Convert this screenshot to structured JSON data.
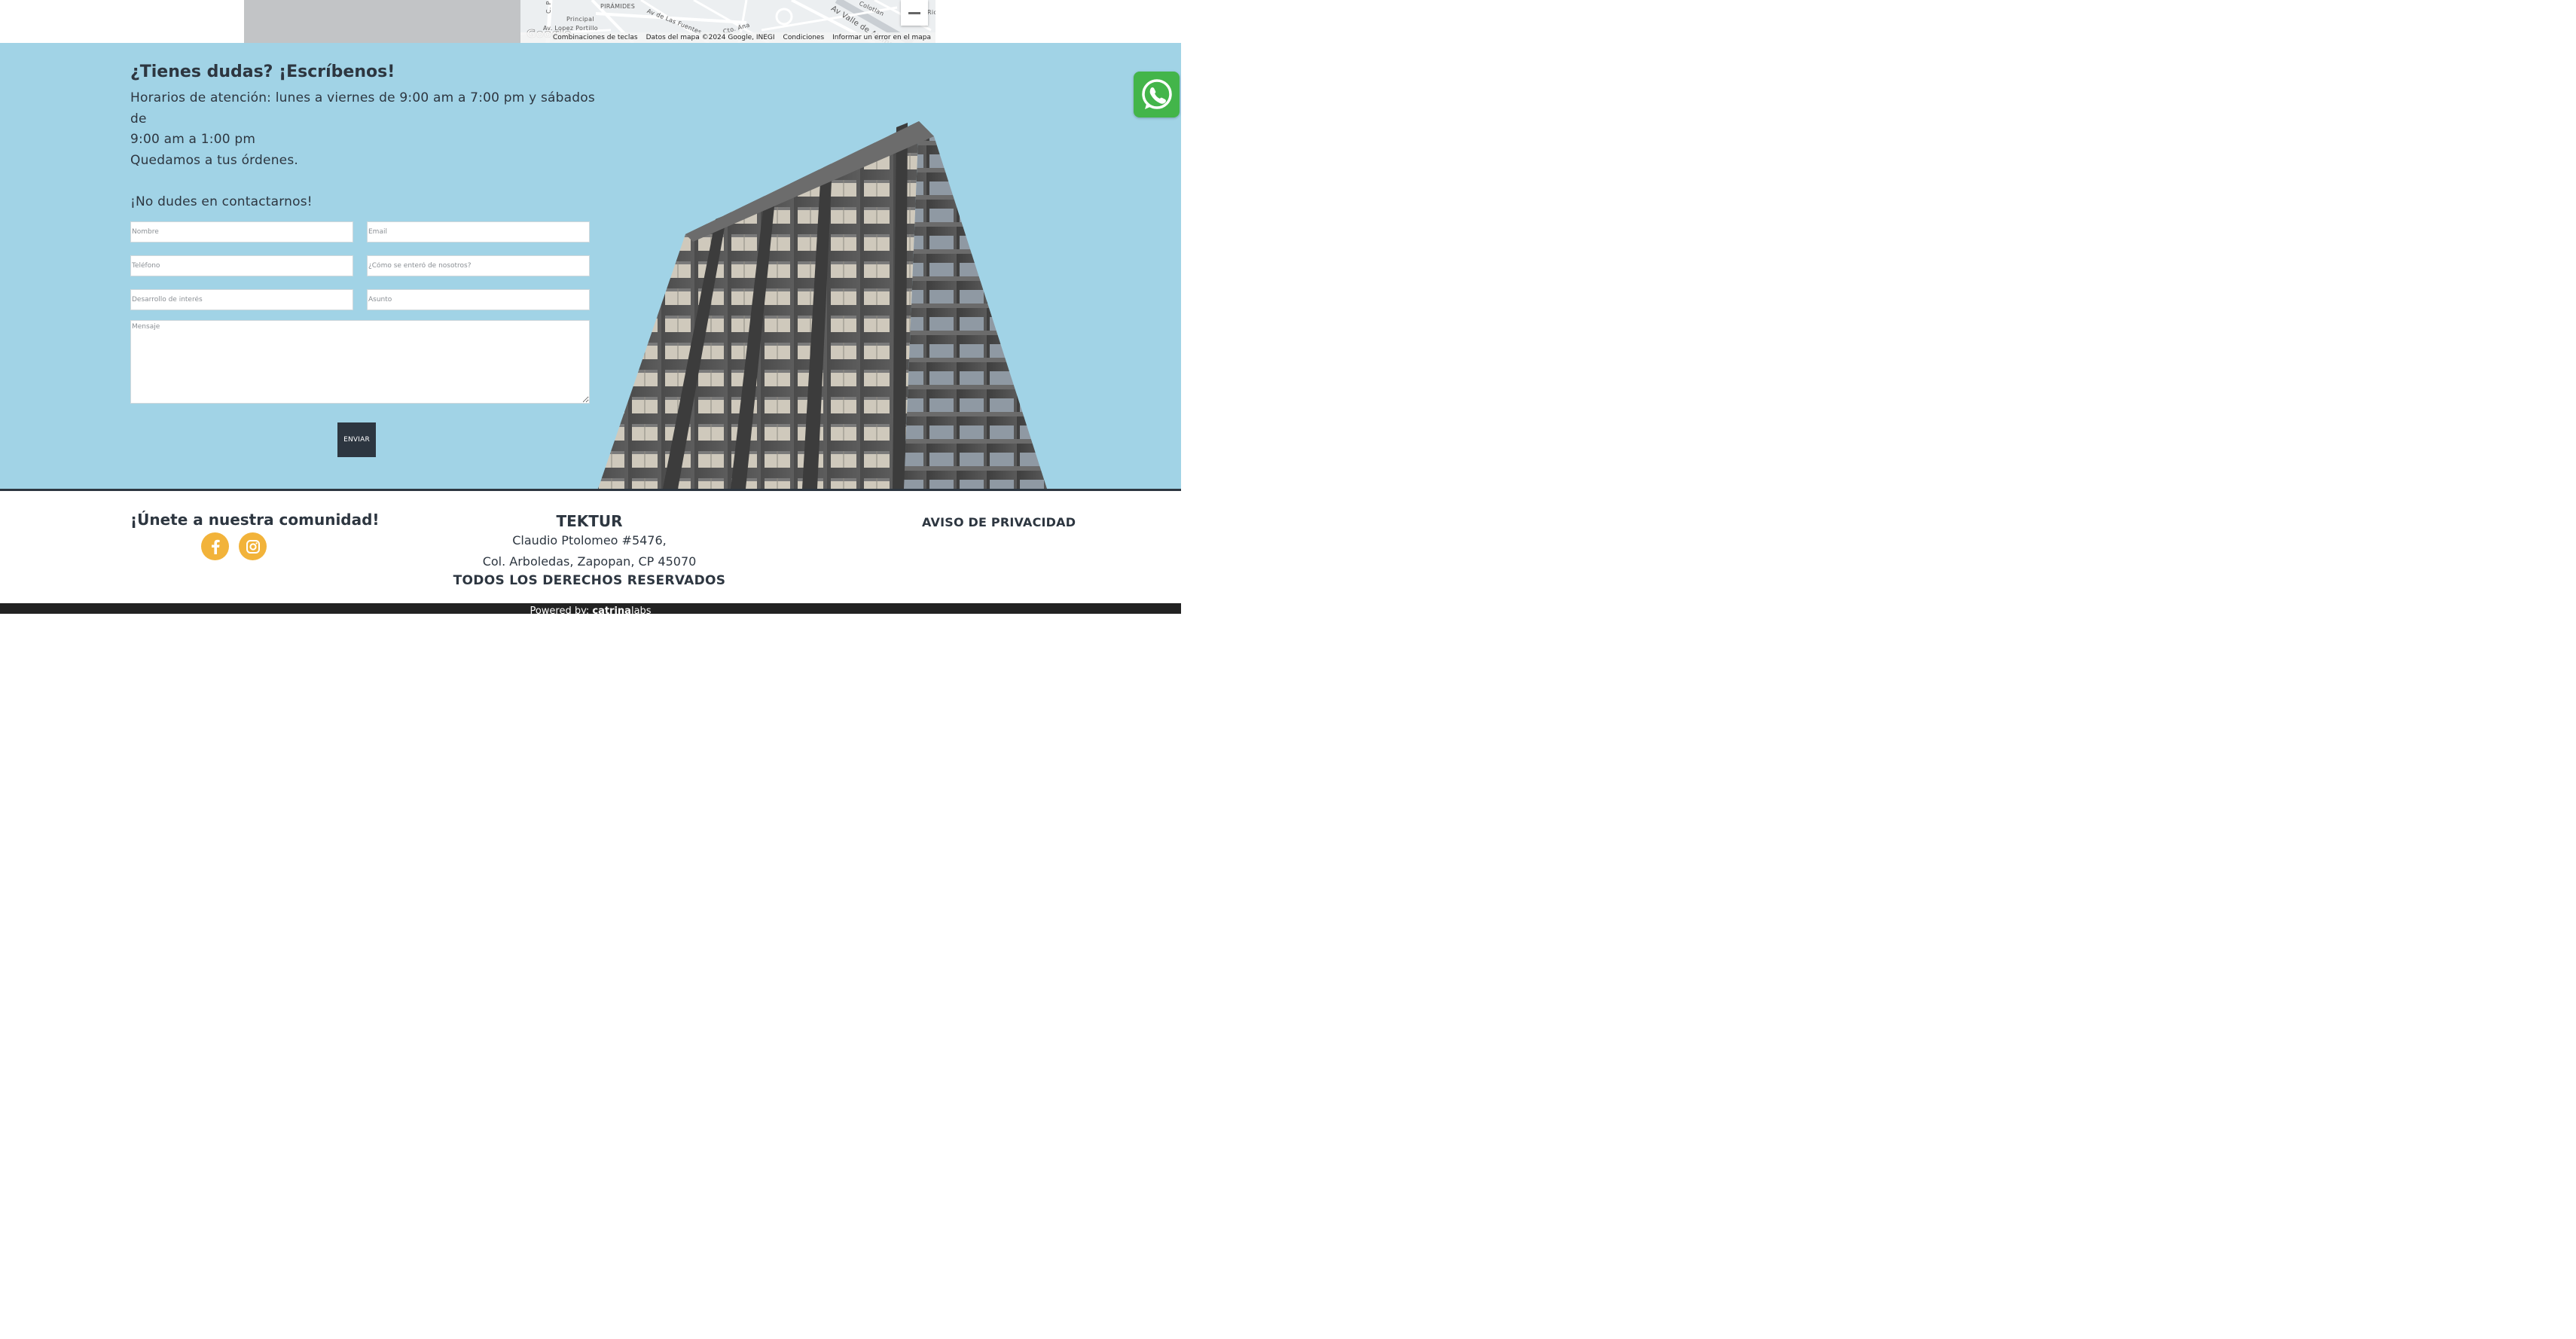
{
  "map": {
    "labels": [
      "PIRÁMIDES",
      "Principal",
      "Av. Lopez Portillo",
      "Av de Las Fuentes",
      "Colotlan",
      "Av Valle de Atemajac",
      "C. P",
      "Cto. Ana",
      "Ric"
    ],
    "google_logo": "Google",
    "attribution": {
      "shortcuts": "Combinaciones de teclas",
      "data": "Datos del mapa ©2024 Google, INEGI",
      "terms": "Condiciones",
      "report": "Informar un error en el mapa"
    }
  },
  "contact": {
    "title": "¿Tienes dudas? ¡Escríbenos!",
    "hours_line1": "Horarios de atención: lunes a viernes de 9:00 am a 7:00 pm y sábados de",
    "hours_line2": "9:00 am a 1:00 pm",
    "at_your_orders": "Quedamos a tus órdenes.",
    "no_doubt": "¡No dudes en contactarnos!",
    "form": {
      "name_placeholder": "Nombre",
      "email_placeholder": "Email",
      "phone_placeholder": "Teléfono",
      "source_placeholder": "¿Cómo se enteró de nosotros?",
      "development_placeholder": "Desarrollo de interés",
      "subject_placeholder": "Asunto",
      "message_placeholder": "Mensaje",
      "submit_label": "ENVIAR"
    }
  },
  "footer": {
    "community_title": "¡Únete a nuestra comunidad!",
    "social": [
      "facebook-icon",
      "instagram-icon"
    ],
    "brand": "TEKTUR",
    "address_line1": "Claudio Ptolomeo #5476,",
    "address_line2": "Col. Arboledas, Zapopan, CP 45070",
    "rights": "TODOS LOS DERECHOS RESERVADOS",
    "privacy_link": "AVISO DE PRIVACIDAD"
  },
  "bottom_bar": {
    "powered_prefix": "Powered by:",
    "powered_brand": "catrina",
    "powered_suffix": "labs"
  },
  "colors": {
    "contact_bg": "#a1d3e6",
    "dark": "#2d3640",
    "social_accent": "#f2b33a",
    "whatsapp": "#43b54a",
    "bottom_bar": "#222222"
  }
}
